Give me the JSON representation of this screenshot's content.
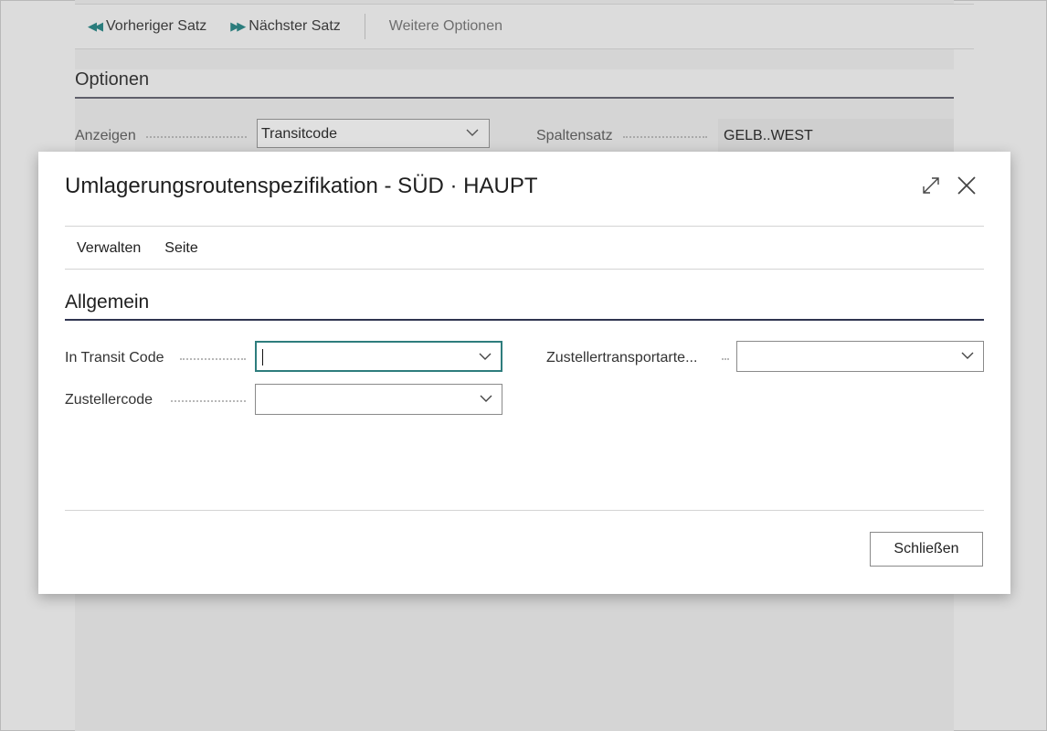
{
  "background": {
    "actions": {
      "prev_record": "Vorheriger Satz",
      "next_record": "Nächster Satz",
      "more_options": "Weitere Optionen"
    },
    "section_title": "Optionen",
    "show_label": "Anzeigen",
    "show_value": "Transitcode",
    "column_set_label": "Spaltensatz",
    "column_set_value": "GELB..WEST"
  },
  "dialog": {
    "title": "Umlagerungsroutenspezifikation - SÜD · HAUPT",
    "menu": [
      "Verwalten",
      "Seite"
    ],
    "section_title": "Allgemein",
    "fields": {
      "in_transit_code": {
        "label": "In Transit Code",
        "value": ""
      },
      "shipping_agent_code": {
        "label": "Zustellercode",
        "value": ""
      },
      "shipping_agent_service": {
        "label": "Zustellertransportarte...",
        "value": ""
      }
    },
    "close_button": "Schließen"
  },
  "colors": {
    "accent": "#2e7d7d",
    "section_underline": "#2f3450",
    "overlay_background": "#dcdcdc"
  }
}
